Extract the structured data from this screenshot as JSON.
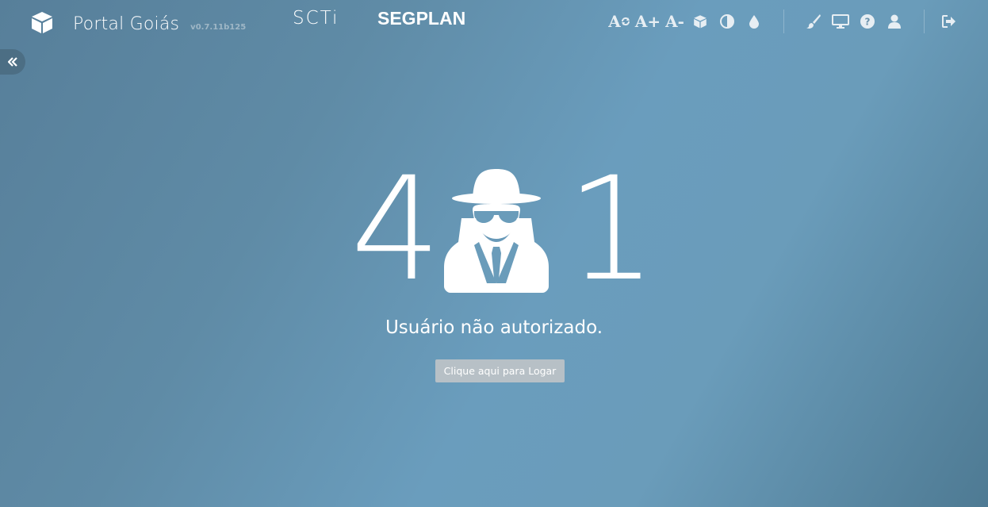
{
  "header": {
    "app_title": "Portal Goiás",
    "version": "v0.7.11b125",
    "logo_scti": "SCTi",
    "logo_segplan": "SEGPLAN",
    "font_reset_label": "A",
    "font_increase_label": "A+",
    "font_decrease_label": "A-"
  },
  "icons": {
    "app": "cube-icon",
    "collapse": "double-chevron-left-icon",
    "font_reset": "font-reset-icon",
    "font_increase": "font-increase-icon",
    "font_decrease": "font-decrease-icon",
    "cube": "cube-icon",
    "contrast": "contrast-icon",
    "grayscale": "drop-icon",
    "theme": "paint-brush-icon",
    "display": "monitor-icon",
    "help": "question-circle-icon",
    "user": "user-icon",
    "logout": "sign-out-icon"
  },
  "error": {
    "code_left": "4",
    "code_right": "1",
    "message": "Usuário não autorizado.",
    "login_button": "Clique aqui para Logar"
  },
  "colors": {
    "background": "#6a9cba",
    "button": "#b7c0c6",
    "text": "#ffffff"
  }
}
